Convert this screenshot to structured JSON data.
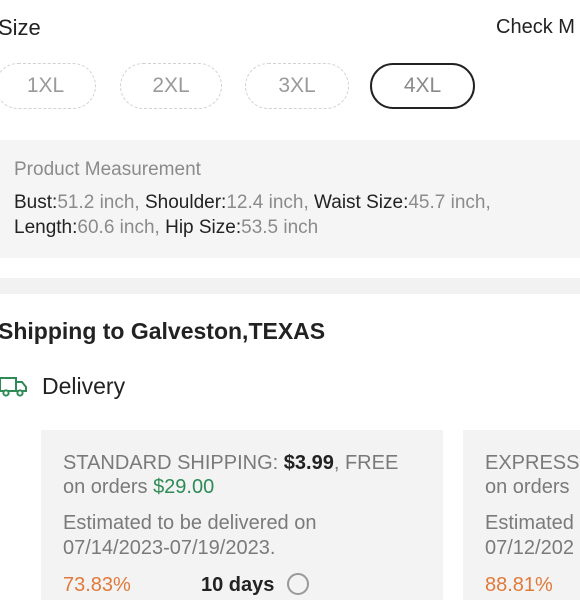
{
  "size": {
    "title": "Size",
    "guide_link": "Check M",
    "options": [
      "1XL",
      "2XL",
      "3XL",
      "4XL"
    ],
    "selected": "4XL"
  },
  "measurement": {
    "title": "Product Measurement",
    "bust_label": "Bust:",
    "bust_value": "51.2 inch,",
    "shoulder_label": "Shoulder:",
    "shoulder_value": "12.4 inch,",
    "waist_label": "Waist Size:",
    "waist_value": "45.7 inch,",
    "length_label": "Length:",
    "length_value": "60.6 inch,",
    "hip_label": "Hip Size:",
    "hip_value": "53.5 inch"
  },
  "shipping": {
    "title": "Shipping to Galveston,TEXAS",
    "delivery_label": "Delivery",
    "standard": {
      "name": "STANDARD SHIPPING: ",
      "price": "$3.99",
      "free_prefix": ", FREE",
      "orders_prefix": "on orders ",
      "threshold": "$29.00",
      "estimate_line1": "Estimated to be delivered on",
      "estimate_line2": "07/14/2023-07/19/2023.",
      "percent": "73.83%",
      "days": "10 days"
    },
    "express": {
      "name": "EXPRESS",
      "orders_prefix": "on orders",
      "estimate_line1": "Estimated",
      "estimate_line2": "07/12/202",
      "percent": "88.81%"
    }
  },
  "colors": {
    "accent_green": "#2e8b57",
    "percent_orange": "#e07a3a",
    "panel_gray": "#f5f5f5"
  }
}
